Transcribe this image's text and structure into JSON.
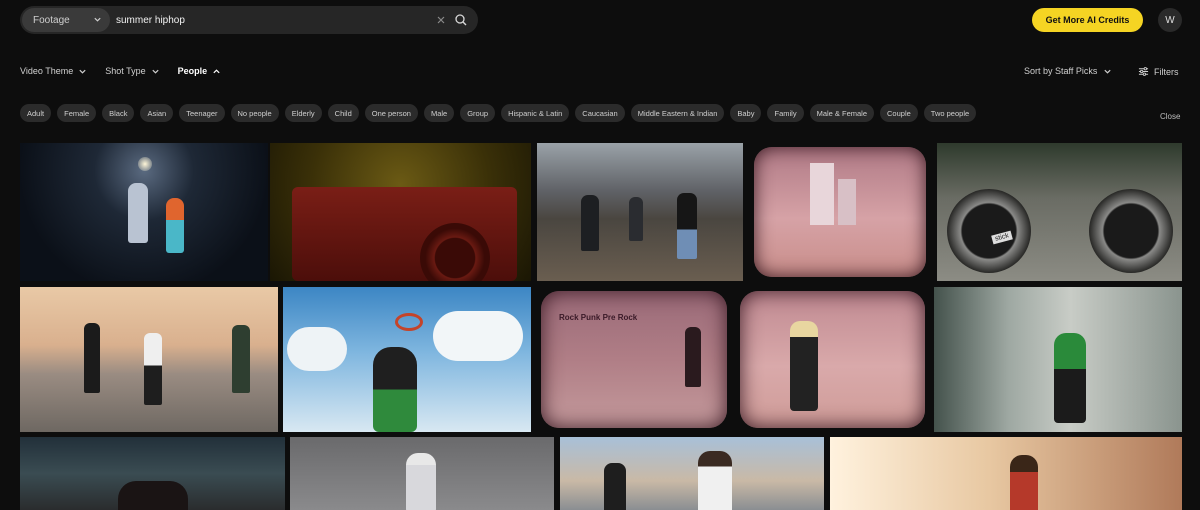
{
  "search": {
    "type_label": "Footage",
    "query": "summer hiphop"
  },
  "header": {
    "credits_label": "Get More AI Credits",
    "avatar_initial": "W"
  },
  "filters": {
    "video_theme": "Video Theme",
    "shot_type": "Shot Type",
    "people": "People",
    "sort_label": "Sort by Staff Picks",
    "filters_label": "Filters",
    "close_label": "Close"
  },
  "chips": [
    "Adult",
    "Female",
    "Black",
    "Asian",
    "Teenager",
    "No people",
    "Elderly",
    "Child",
    "One person",
    "Male",
    "Group",
    "Hispanic & Latin",
    "Caucasian",
    "Middle Eastern & Indian",
    "Baby",
    "Family",
    "Male & Female",
    "Couple",
    "Two people"
  ],
  "tile_text": {
    "cassette_label": "stick",
    "graffiti_text": "Rock Punk Pre Rock"
  },
  "colors": {
    "accent": "#f5d423",
    "background": "#0d0d0d",
    "chip_bg": "#2b2b2b"
  }
}
